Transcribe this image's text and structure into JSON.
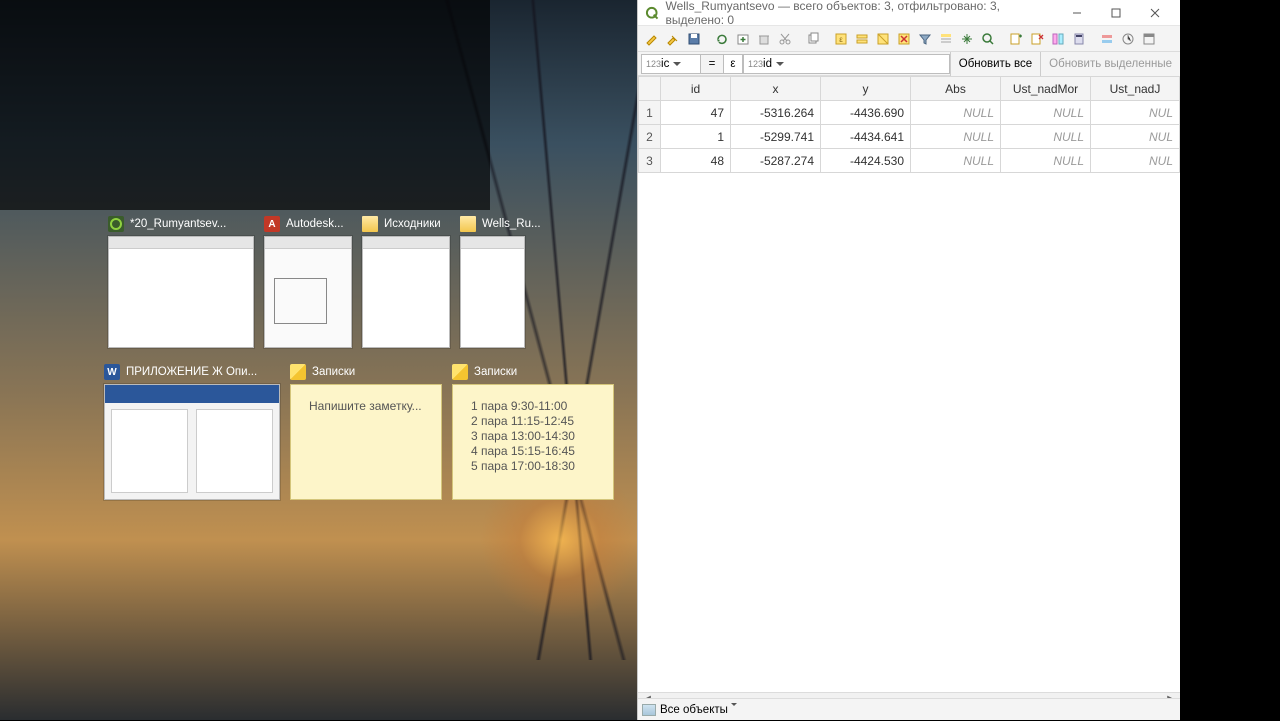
{
  "taskview": {
    "tiles": [
      {
        "icon": "qgis",
        "label": "*20_Rumyantsev..."
      },
      {
        "icon": "acad",
        "label": "Autodesk..."
      },
      {
        "icon": "folder",
        "label": "Исходники"
      },
      {
        "icon": "folder",
        "label": "Wells_Ru..."
      },
      {
        "icon": "word",
        "label": "ПРИЛОЖЕНИЕ Ж Опи..."
      },
      {
        "icon": "note",
        "label": "Записки"
      },
      {
        "icon": "note",
        "label": "Записки"
      }
    ],
    "sticky1_placeholder": "Напишите заметку...",
    "sticky2_lines": [
      "1 пара   9:30-11:00",
      "2 пара  11:15-12:45",
      "3 пара  13:00-14:30",
      "4 пара  15:15-16:45",
      "5 пара  17:00-18:30"
    ]
  },
  "qgis": {
    "title": "Wells_Rumyantsevo — всего объектов: 3, отфильтровано: 3, выделено: 0",
    "field_selector_prefix": "123",
    "field_selector": "ic",
    "expr_eq": "=",
    "expr_eps": "ε",
    "expr_prefix": "123",
    "expr_field": "id",
    "btn_update_all": "Обновить все",
    "btn_update_selected": "Обновить выделенные",
    "columns": [
      "id",
      "x",
      "y",
      "Abs",
      "Ust_nadMor",
      "Ust_nadJ"
    ],
    "rows": [
      {
        "n": "1",
        "id": "47",
        "x": "-5316.264",
        "y": "-4436.690",
        "abs": "NULL",
        "m": "NULL",
        "j": "NUL"
      },
      {
        "n": "2",
        "id": "1",
        "x": "-5299.741",
        "y": "-4434.641",
        "abs": "NULL",
        "m": "NULL",
        "j": "NUL"
      },
      {
        "n": "3",
        "id": "48",
        "x": "-5287.274",
        "y": "-4424.530",
        "abs": "NULL",
        "m": "NULL",
        "j": "NUL"
      }
    ],
    "status_filter": "Все объекты"
  }
}
